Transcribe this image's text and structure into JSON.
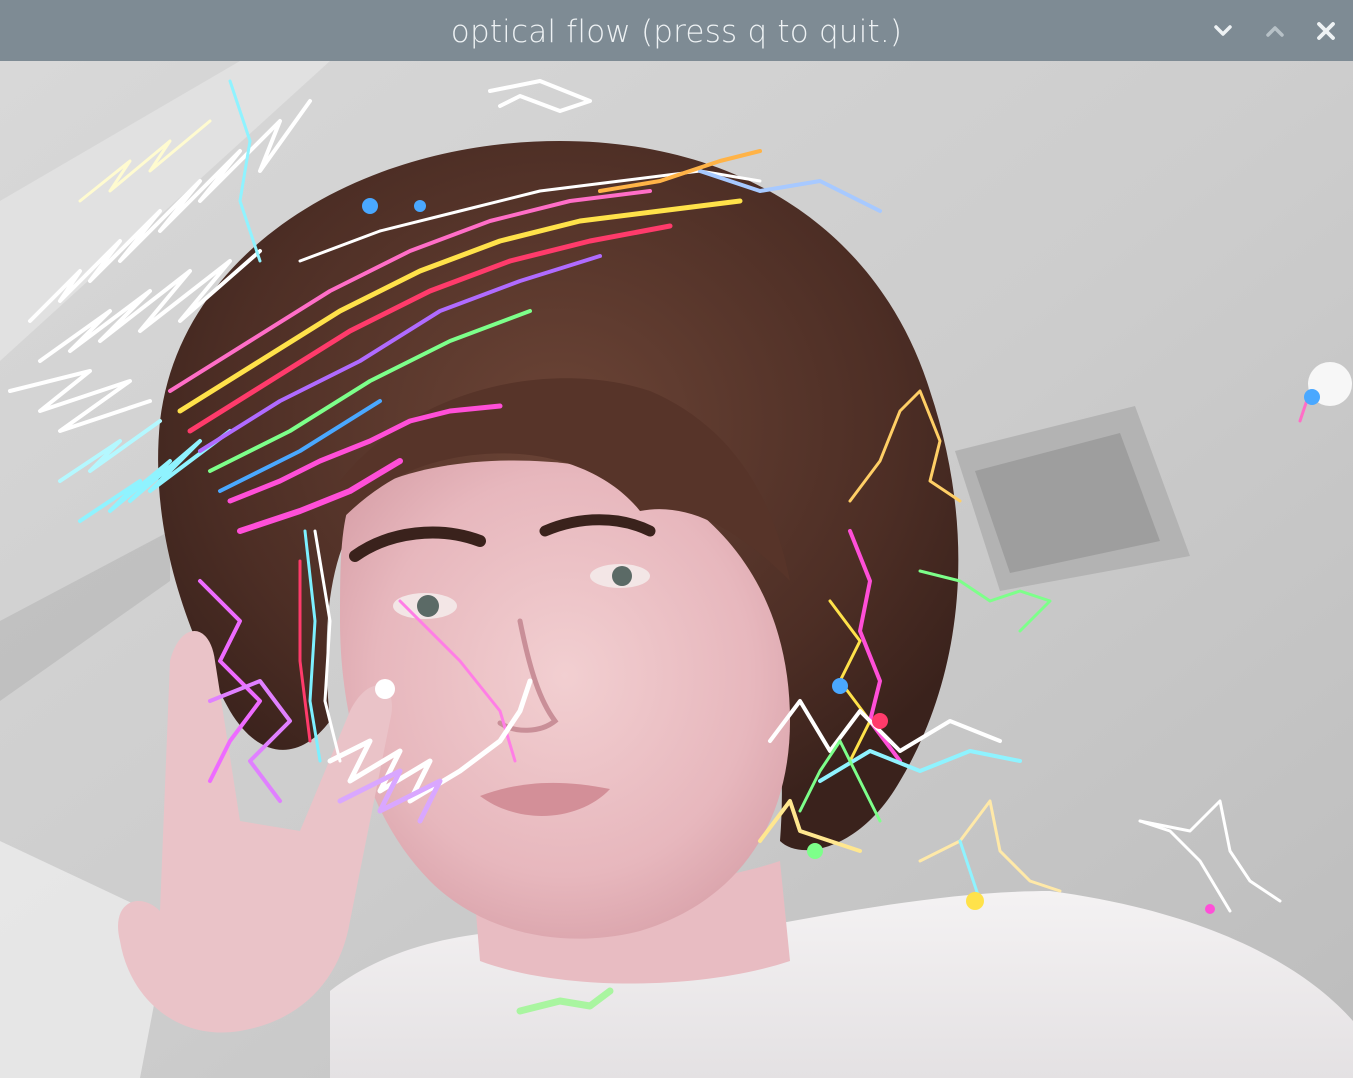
{
  "window": {
    "title": "optical flow (press q to quit.)",
    "controls": {
      "minimize_icon": "chevron-down-icon",
      "maximize_icon": "chevron-up-icon",
      "close_icon": "close-icon"
    }
  },
  "colors": {
    "titlebar": "#7e8b94",
    "title_text": "#eef2f4",
    "track_colors": [
      "#ffffff",
      "#ff4fd8",
      "#ffe24a",
      "#7cf0ff",
      "#ff3b6b",
      "#b06bff",
      "#7dff8a",
      "#4aa8ff",
      "#ffb347",
      "#e08bff"
    ]
  },
  "scene": {
    "description_visible": false
  }
}
